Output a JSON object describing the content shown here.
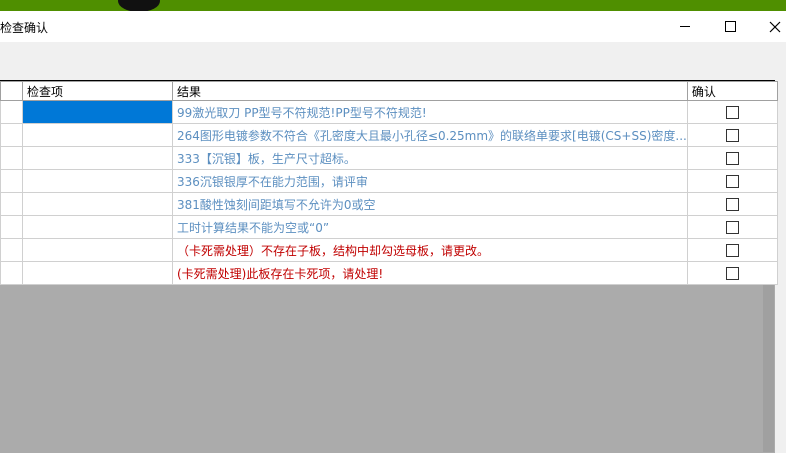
{
  "window": {
    "title": "检查确认"
  },
  "table": {
    "headers": [
      "检查项",
      "结果",
      "确认"
    ],
    "rows": [
      {
        "item": "",
        "result": "99激光取刀 PP型号不符规范!PP型号不符规范!",
        "color": "#5c8fc0",
        "selected": true
      },
      {
        "item": "",
        "result": "264图形电镀参数不符合《孔密度大且最小孔径≤0.25mm》的联络单要求[电镀(CS+SS)密度...",
        "color": "#5c8fc0"
      },
      {
        "item": "",
        "result": "333【沉银】板，生产尺寸超标。",
        "color": "#5c8fc0"
      },
      {
        "item": "",
        "result": "336沉银银厚不在能力范围，请评审",
        "color": "#5c8fc0"
      },
      {
        "item": "",
        "result": "381酸性蚀刻间距填写不允许为0或空",
        "color": "#5c8fc0"
      },
      {
        "item": "",
        "result": "工时计算结果不能为空或“0”",
        "color": "#5c8fc0"
      },
      {
        "item": "",
        "result": "（卡死需处理）不存在子板，结构中却勾选母板，请更改。",
        "color": "#c00000"
      },
      {
        "item": "",
        "result": "(卡死需处理)此板存在卡死项，请处理!",
        "color": "#c00000"
      }
    ]
  }
}
